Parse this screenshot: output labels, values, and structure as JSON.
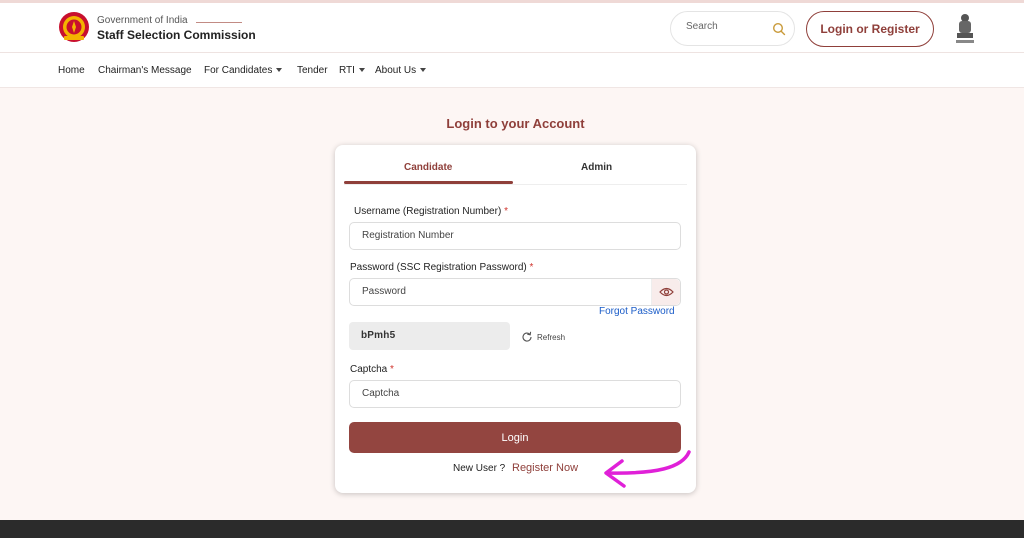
{
  "header": {
    "gov_text": "Government of India",
    "org_name": "Staff Selection Commission",
    "search_placeholder": "Search",
    "login_register_label": "Login or Register"
  },
  "nav": {
    "items": [
      {
        "label": "Home"
      },
      {
        "label": "Chairman's Message"
      },
      {
        "label": "For Candidates"
      },
      {
        "label": "Tender"
      },
      {
        "label": "RTI"
      },
      {
        "label": "About Us"
      }
    ]
  },
  "login": {
    "title": "Login to your Account",
    "tabs": [
      "Candidate",
      "Admin"
    ],
    "active_tab": "Candidate",
    "username_label": "Username (Registration Number)",
    "username_placeholder": "Registration Number",
    "password_label": "Password (SSC Registration Password)",
    "password_placeholder": "Password",
    "forgot_password": "Forgot Password",
    "captcha_code": "bPmh5",
    "refresh_label": "Refresh",
    "captcha_label": "Captcha",
    "captcha_placeholder": "Captcha",
    "required_mark": "*",
    "login_button": "Login",
    "new_user_text": "New User ?",
    "register_now": "Register Now"
  },
  "colors": {
    "brand": "#8f3f3a",
    "link": "#1a5cc8",
    "required": "#d0332c",
    "annotation_arrow": "#e020d8",
    "footer": "#2b2b2b"
  },
  "icons": [
    "ssc-logo-icon",
    "search-icon",
    "national-emblem-icon",
    "eye-icon",
    "refresh-icon",
    "annotation-arrow-icon"
  ]
}
